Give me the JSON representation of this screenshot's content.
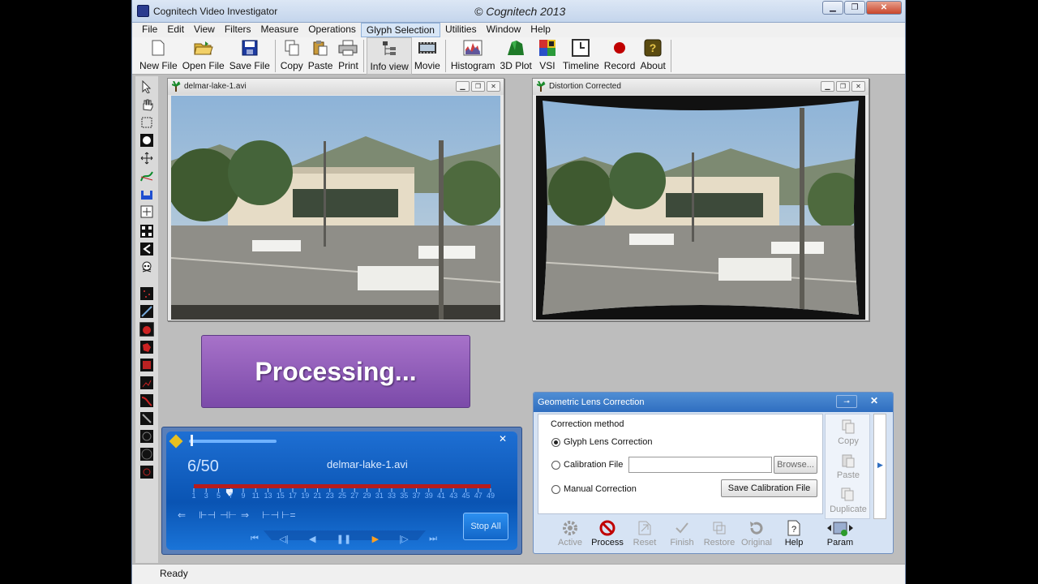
{
  "window": {
    "title": "Cognitech Video Investigator",
    "center_title": "© Cognitech 2013"
  },
  "menu": [
    "File",
    "Edit",
    "View",
    "Filters",
    "Measure",
    "Operations",
    "Glyph Selection",
    "Utilities",
    "Window",
    "Help"
  ],
  "toolbar": {
    "new_file": "New File",
    "open_file": "Open File",
    "save_file": "Save File",
    "copy": "Copy",
    "paste": "Paste",
    "print": "Print",
    "info_view": "Info view",
    "movie": "Movie",
    "histogram": "Histogram",
    "plot3d": "3D Plot",
    "vsi": "VSI",
    "timeline": "Timeline",
    "record": "Record",
    "about": "About"
  },
  "windows": {
    "source": "delmar-lake-1.avi",
    "corrected": "Distortion Corrected"
  },
  "processing": "Processing...",
  "player": {
    "frame": "6/50",
    "file": "delmar-lake-1.avi",
    "ticks": [
      "1",
      "3",
      "5",
      "7",
      "9",
      "11",
      "13",
      "15",
      "17",
      "19",
      "21",
      "23",
      "25",
      "27",
      "29",
      "31",
      "33",
      "35",
      "37",
      "39",
      "41",
      "43",
      "45",
      "47",
      "49"
    ],
    "progress": 0.12,
    "stop": "Stop All"
  },
  "lens": {
    "title": "Geometric Lens Correction",
    "group": "Correction method",
    "opt_glyph": "Glyph Lens Correction",
    "opt_calib": "Calibration File",
    "opt_manual": "Manual Correction",
    "browse": "Browse...",
    "save_calib": "Save Calibration File",
    "actions": {
      "active": "Active",
      "process": "Process",
      "reset": "Reset",
      "finish": "Finish",
      "restore": "Restore",
      "original": "Original",
      "help": "Help",
      "param": "Param"
    },
    "side": {
      "copy": "Copy",
      "paste": "Paste",
      "duplicate": "Duplicate"
    }
  },
  "status": "Ready",
  "colors": {
    "accent": "#2f6ec0",
    "processing": "#8c5bb8",
    "record": "#c00000"
  }
}
